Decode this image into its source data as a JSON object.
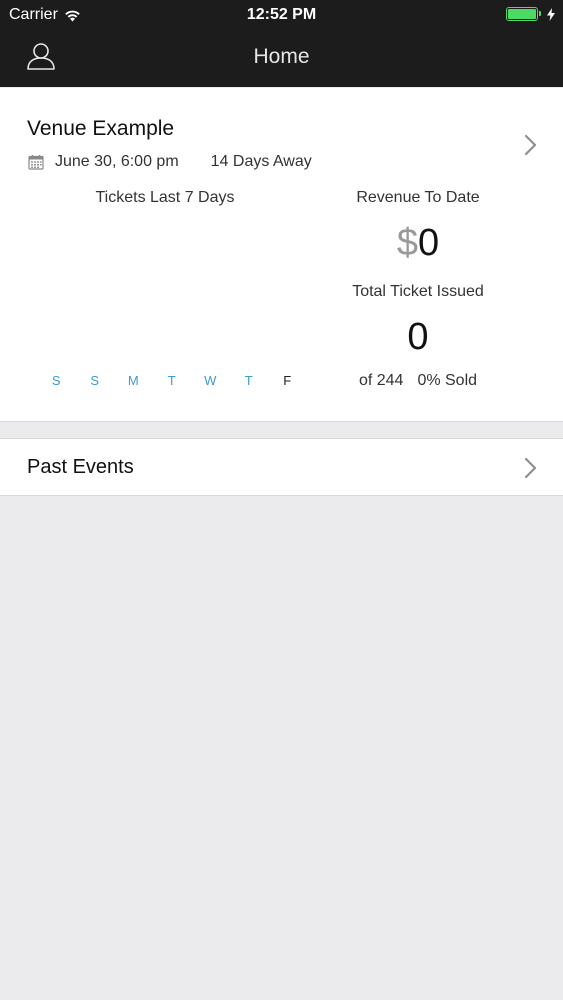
{
  "status_bar": {
    "carrier": "Carrier",
    "time": "12:52 PM",
    "wifi_icon": "wifi-icon",
    "battery_icon": "battery-icon",
    "charging_icon": "bolt-icon"
  },
  "nav": {
    "title": "Home",
    "profile_icon": "user-profile-icon"
  },
  "event": {
    "venue_name": "Venue Example",
    "date": "June 30, 6:00 pm",
    "days_away": "14 Days Away",
    "tickets_label": "Tickets Last 7 Days",
    "weekdays": [
      {
        "label": "S",
        "color": "#3d9bd1"
      },
      {
        "label": "S",
        "color": "#3d9bd1"
      },
      {
        "label": "M",
        "color": "#3d9bd1"
      },
      {
        "label": "T",
        "color": "#3d9bd1"
      },
      {
        "label": "W",
        "color": "#3d9bd1"
      },
      {
        "label": "T",
        "color": "#3d9bd1"
      },
      {
        "label": "F",
        "color": "#222222"
      }
    ],
    "revenue_label": "Revenue To Date",
    "revenue_currency": "$",
    "revenue_amount": "0",
    "issued_label": "Total Ticket Issued",
    "issued_value": "0",
    "capacity": "of 244",
    "sold_percent": "0% Sold"
  },
  "past_events": {
    "label": "Past Events"
  },
  "colors": {
    "nav_background": "#1c1c1c",
    "accent_blue": "#3d9bd1",
    "battery_green": "#4cd964",
    "page_background": "#ebeaed"
  }
}
